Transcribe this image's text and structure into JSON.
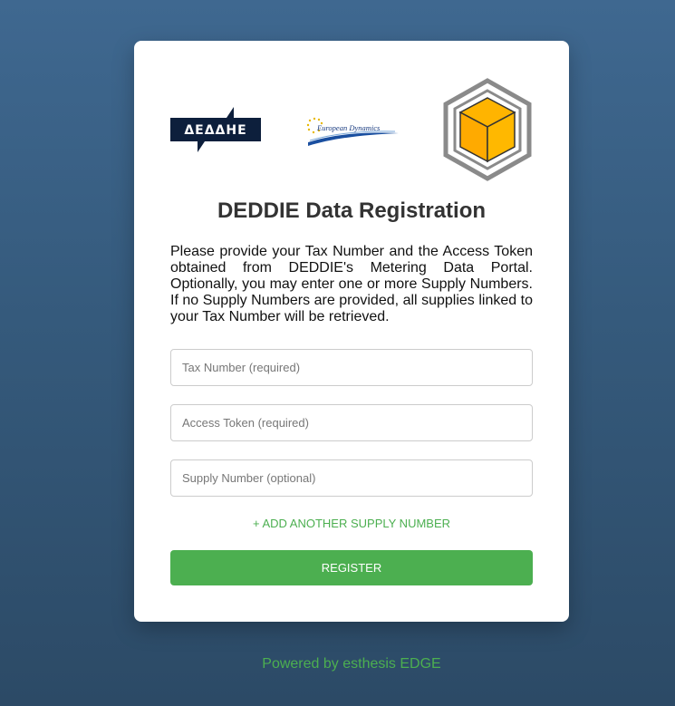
{
  "logos": {
    "deddhe_text": "ΔΕΔΔΗΕ",
    "european_dynamics_text": "European Dynamics"
  },
  "form": {
    "title": "DEDDIE Data Registration",
    "description": "Please provide your Tax Number and the Access Token obtained from DEDDIE's Metering Data Portal. Optionally, you may enter one or more Supply Numbers. If no Supply Numbers are provided, all supplies linked to your Tax Number will be retrieved.",
    "tax_number_placeholder": "Tax Number (required)",
    "access_token_placeholder": "Access Token (required)",
    "supply_number_placeholder": "Supply Number (optional)",
    "add_supply_label": "+ ADD ANOTHER SUPPLY NUMBER",
    "register_label": "REGISTER"
  },
  "footer": {
    "powered_by": "Powered by esthesis EDGE"
  },
  "colors": {
    "accent": "#4caf50",
    "background_top": "#3f6890",
    "background_bottom": "#2c4a66",
    "deddhe_navy": "#0d1f3c",
    "box_orange": "#ffb000"
  },
  "icons": [
    "deddhe-logo-icon",
    "european-dynamics-logo-icon",
    "esthesis-cube-logo-icon"
  ]
}
